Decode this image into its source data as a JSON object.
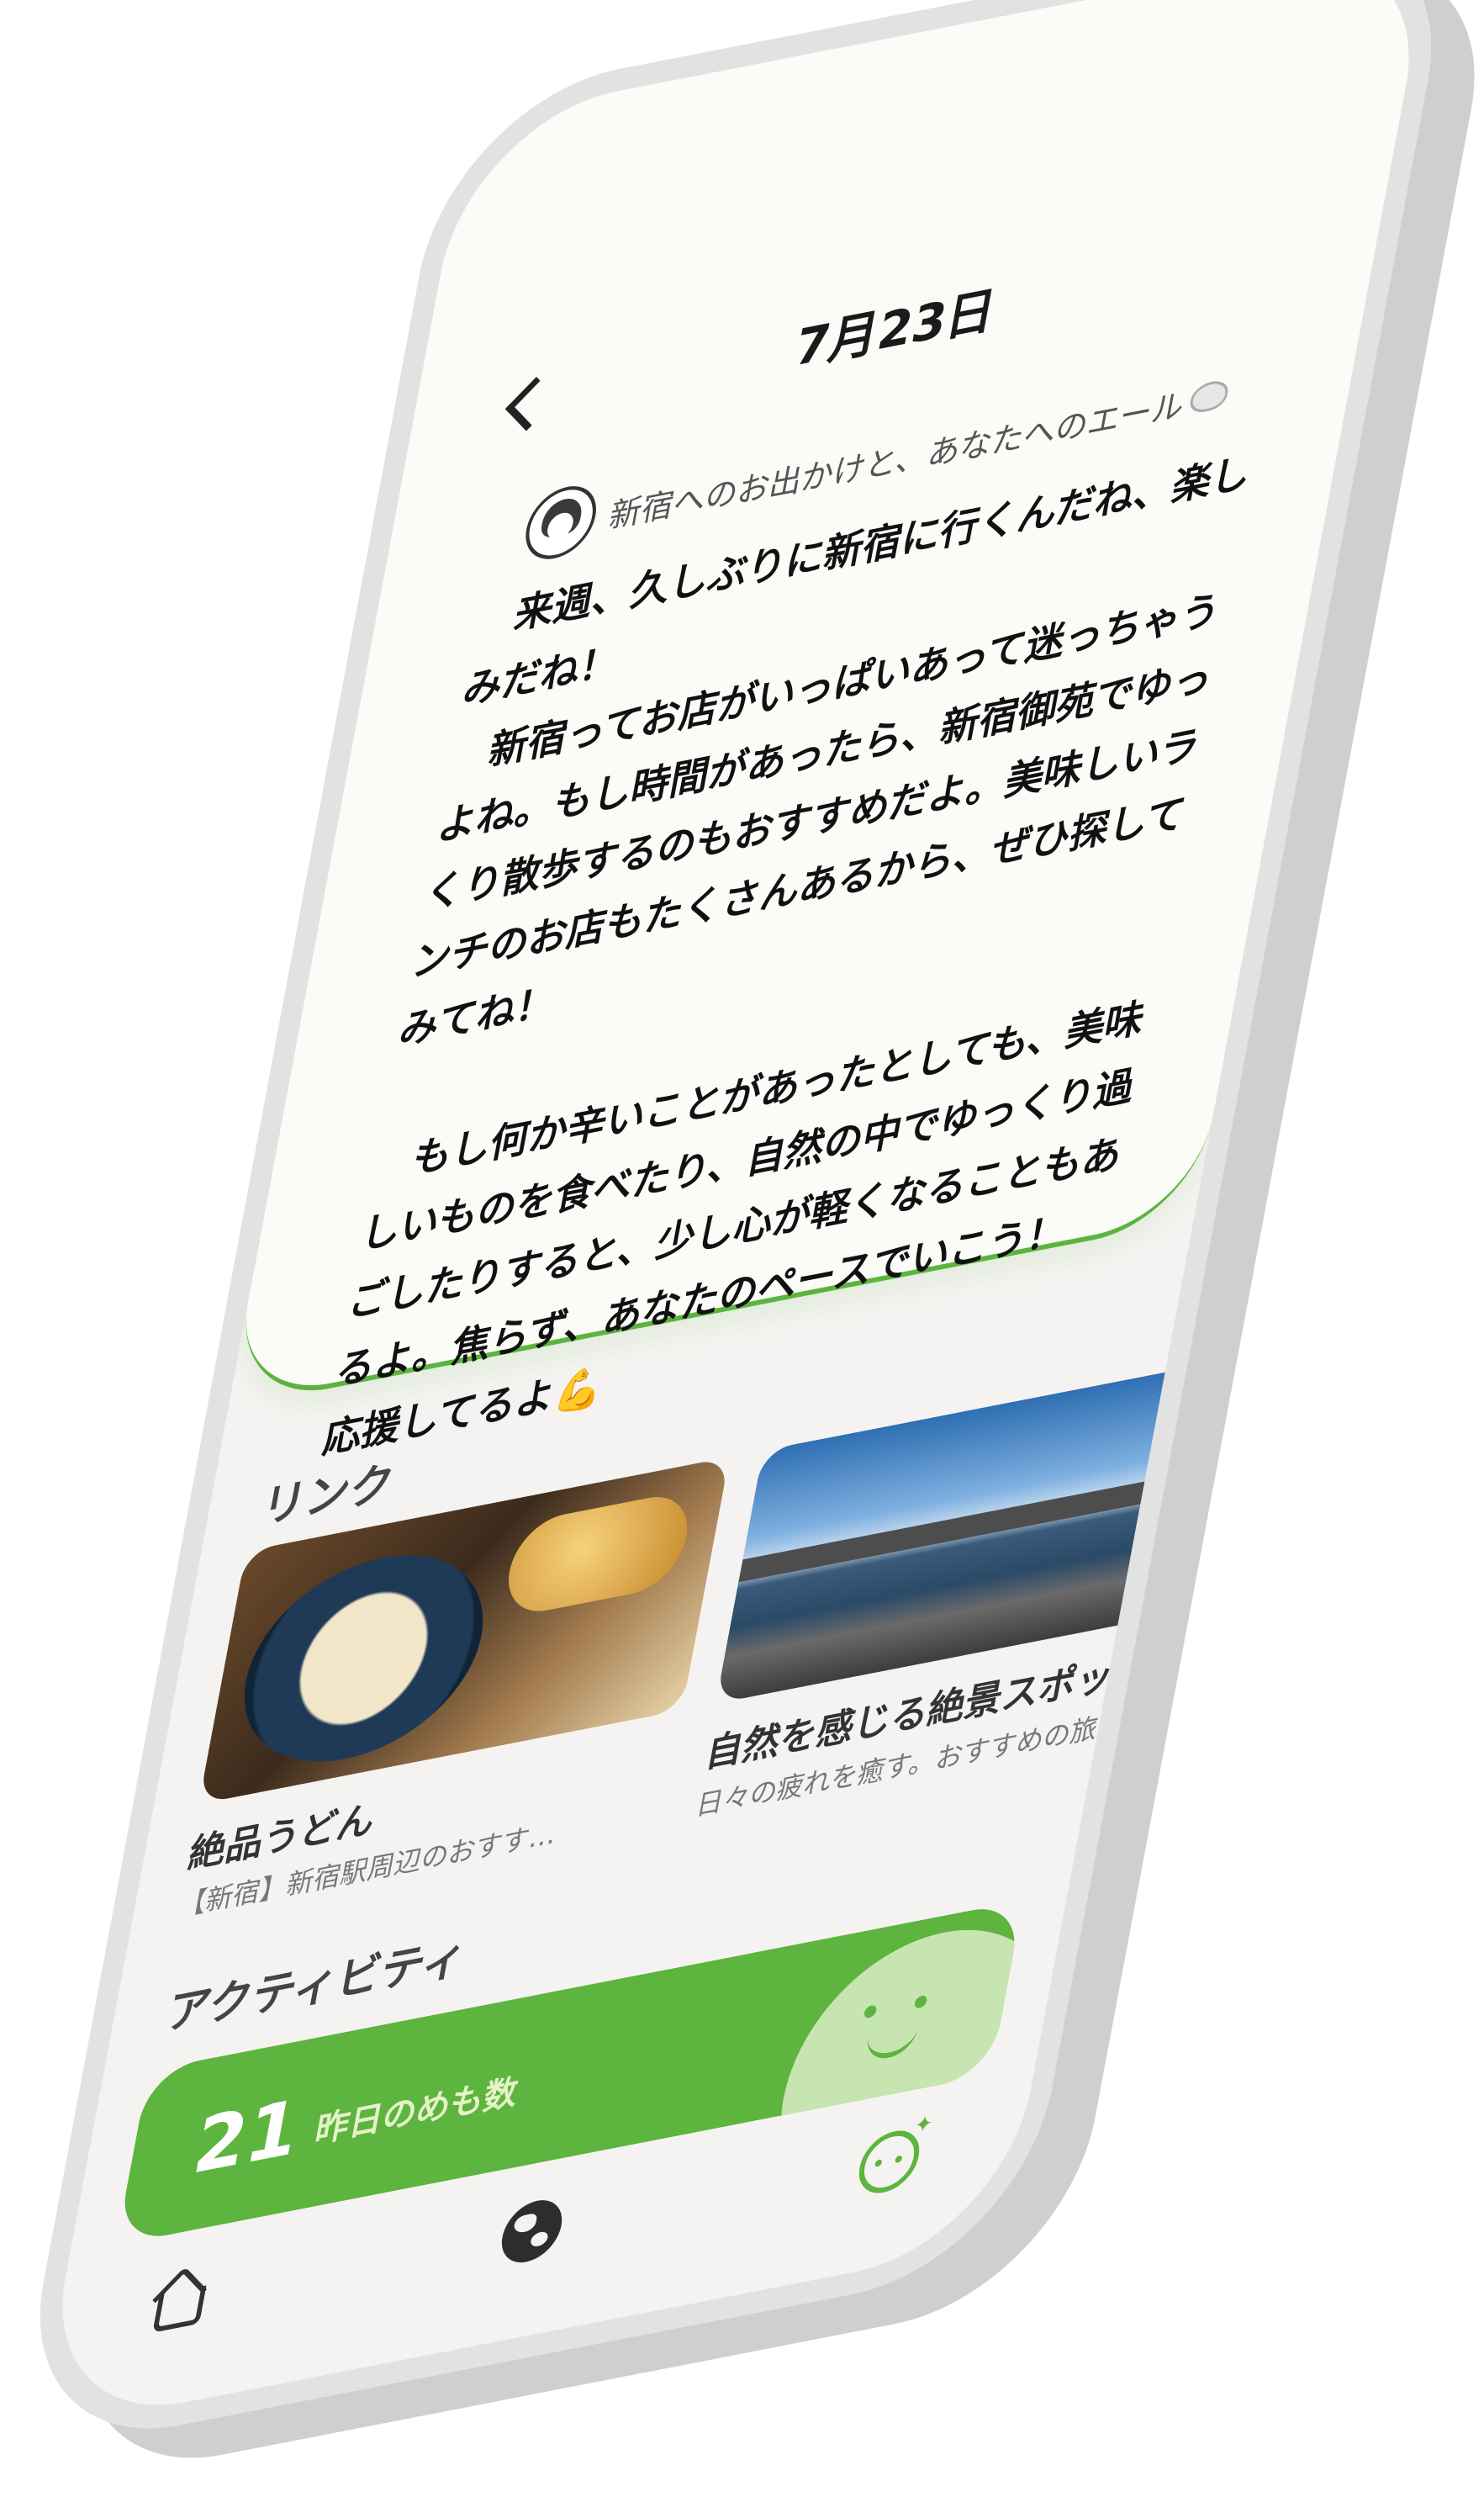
{
  "header": {
    "date": "7月23日",
    "subtitle": "新宿へのお出かけと、あなたへのエール"
  },
  "message": {
    "text": "　来週、久しぶりに新宿に行くんだね、楽しみだね！\n　新宿ってお店がいっぱいあって迷っちゃうよね。もし時間があったら、新宿御苑でゆっくり散歩するのもおすすめだよ。美味しいランチのお店もたくさんあるから、ぜひ探してみてね！\n\n　もし何か辛いことがあったとしても、美味しいものを食べたり、自然の中でゆっくり過ごしたりすると、少し心が軽くなることもあるよ。焦らず、あなたのペースでいこう！\n応援してるよ💪"
  },
  "links": {
    "section_title": "リンク",
    "items": [
      {
        "title": "絶品うどん",
        "description": "【新宿】新宿駅周辺のおすす…"
      },
      {
        "title": "自然を感じる絶景スポッ",
        "description": "日々の疲れを癒す。おすすめの旅"
      }
    ]
  },
  "activity": {
    "section_title": "アクティビティ",
    "count": "21",
    "label": "昨日のめも数"
  },
  "tabbar": {
    "items": [
      {
        "icon": "home-icon"
      },
      {
        "icon": "globe-icon"
      },
      {
        "icon": "face-icon"
      }
    ]
  },
  "colors": {
    "accent": "#5db43e",
    "accent_light": "#c7e5b1",
    "screen_bg": "#f5f3f1",
    "card_bg": "#fbfbf8"
  }
}
